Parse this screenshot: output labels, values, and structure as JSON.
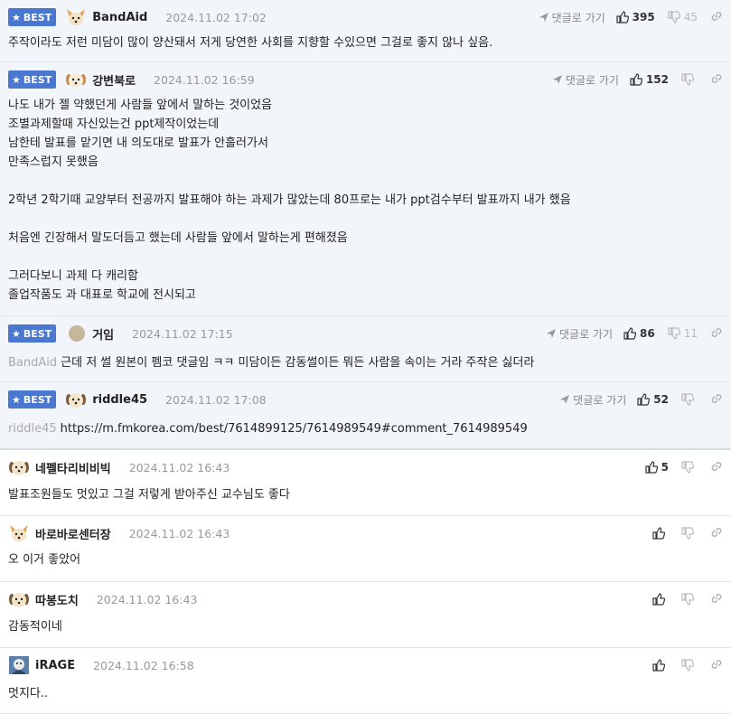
{
  "labels": {
    "best": "BEST",
    "reply": "댓글로 가기"
  },
  "comments": [
    {
      "best": true,
      "nick": "BandAid",
      "date": "2024.11.02 17:02",
      "up": "395",
      "down": "45",
      "text": "주작이라도 저런 미담이 많이 양산돼서 저게 당연한 사회를 지향할 수있으면 그걸로 좋지 않나 싶음."
    },
    {
      "best": true,
      "nick": "강변북로",
      "date": "2024.11.02 16:59",
      "up": "152",
      "down": "",
      "text": "나도 내가 젤 약했던게 사람들 앞에서 말하는 것이었음\n조별과제할때 자신있는건 ppt제작이었는데\n남한테 발표를 맡기면 내 의도대로 발표가 안흘러가서\n만족스럽지 못했음\n\n2학년 2학기때 교양부터 전공까지 발표해야 하는 과제가 많았는데 80프로는 내가 ppt검수부터 발표까지 내가 했음\n\n처음엔 긴장해서 말도더듬고 했는데 사람들 앞에서 말하는게 편해졌음\n\n그러다보니 과제 다 캐리함\n졸업작품도 과 대표로 학교에 전시되고"
    },
    {
      "best": true,
      "nick": "거임",
      "date": "2024.11.02 17:15",
      "up": "86",
      "down": "11",
      "parent": "BandAid",
      "text": "근데 저 썰 원본이 펨코 댓글임 ㅋㅋ 미담이든 감동썰이든 뭐든 사람을 속이는 거라 주작은 싫더라"
    },
    {
      "best": true,
      "nick": "riddle45",
      "date": "2024.11.02 17:08",
      "up": "52",
      "down": "",
      "parent": "riddle45",
      "text": "https://m.fmkorea.com/best/7614899125/7614989549#comment_7614989549"
    },
    {
      "best": false,
      "nick": "네펠타리비비빅",
      "date": "2024.11.02 16:43",
      "up": "5",
      "down": "",
      "text": "발표조원들도 멋있고 그걸 저렇게 받아주신 교수님도 좋다"
    },
    {
      "best": false,
      "nick": "바로바로센터장",
      "date": "2024.11.02 16:43",
      "up": "",
      "down": "",
      "text": "오 이거 좋았어"
    },
    {
      "best": false,
      "nick": "따봉도치",
      "date": "2024.11.02 16:43",
      "up": "",
      "down": "",
      "text": "감동적이네"
    },
    {
      "best": false,
      "nick": "iRAGE",
      "date": "2024.11.02 16:58",
      "up": "",
      "down": "",
      "text": "멋지다.."
    }
  ]
}
